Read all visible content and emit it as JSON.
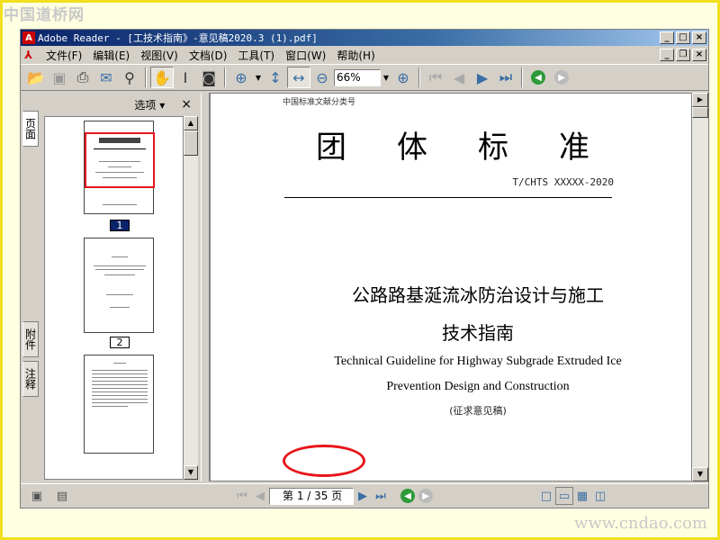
{
  "watermark_top": "中国道桥网",
  "watermark_bottom": "www.cndao.com",
  "window": {
    "title": "Adobe Reader - [工技术指南》-意见稿2020.3 (1).pdf]",
    "app_icon": "adobe-reader-icon"
  },
  "menu": {
    "items": [
      "文件(F)",
      "编辑(E)",
      "视图(V)",
      "文档(D)",
      "工具(T)",
      "窗口(W)",
      "帮助(H)"
    ]
  },
  "toolbar": {
    "zoom_value": "66%",
    "icons": [
      "open-folder-icon",
      "save-icon",
      "print-icon",
      "email-icon",
      "search-binoculars-icon",
      "hand-tool-icon",
      "select-text-icon",
      "snapshot-icon",
      "zoom-in-icon",
      "fit-height-icon",
      "fit-width-icon",
      "zoom-out-icon",
      "zoom-plus-icon",
      "first-page-icon",
      "prev-page-icon",
      "next-page-icon",
      "last-page-icon",
      "go-back-icon",
      "go-forward-icon"
    ]
  },
  "side_tabs": {
    "pages": "页面",
    "attachments": "附件",
    "comments": "注释"
  },
  "thumbnails": {
    "options_label": "选项",
    "pages": [
      {
        "number": "1",
        "selected": true
      },
      {
        "number": "2",
        "selected": false
      }
    ]
  },
  "document": {
    "classification": "中国标准文献分类号",
    "title": "团体标准",
    "code": "T/CHTS XXXXX-2020",
    "cn_title_1": "公路路基涎流冰防治设计与施工",
    "cn_title_2": "技术指南",
    "en_title_1": "Technical Guideline for Highway Subgrade Extruded Ice",
    "en_title_2": "Prevention Design and Construction",
    "note": "(征求意见稿)"
  },
  "statusbar": {
    "page_indicator": "第 1 / 35 页"
  },
  "colors": {
    "titlebar": "#0a246a",
    "highlight_oval": "#e8141c",
    "selected_thumb": "#0a246a"
  }
}
